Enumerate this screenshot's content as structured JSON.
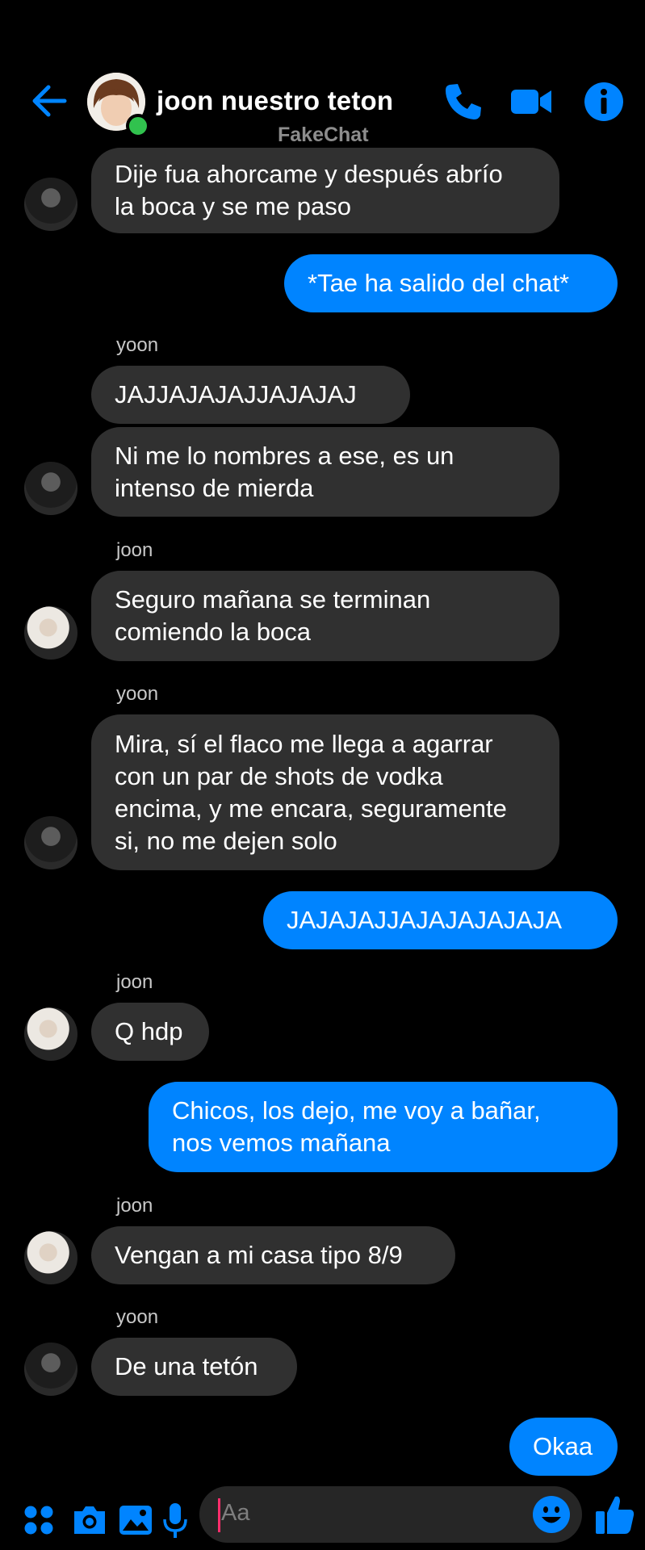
{
  "header": {
    "title": "joon nuestro teton",
    "subtitle": "FakeChat"
  },
  "messages": [
    {
      "text": "Dije fua ahorcame y después abrío\nla boca y se me paso"
    },
    {
      "text": "*Tae ha salido del chat*"
    },
    {
      "sender": "yoon"
    },
    {
      "text": "JAJJAJAJAJJAJAJAJ"
    },
    {
      "text": "Ni me lo nombres a ese, es un\nintenso de mierda"
    },
    {
      "sender": "joon"
    },
    {
      "text": "Seguro mañana se terminan\ncomiendo la boca"
    },
    {
      "sender": "yoon"
    },
    {
      "text": "Mira, sí el flaco me llega a agarrar\ncon un par de shots de vodka\nencima, y me encara, seguramente\nsi, no me dejen solo"
    },
    {
      "text": "JAJAJAJJAJAJAJAJAJA"
    },
    {
      "sender": "joon"
    },
    {
      "text": "Q hdp"
    },
    {
      "text": "Chicos, los dejo, me voy a bañar,\nnos vemos mañana"
    },
    {
      "sender": "joon"
    },
    {
      "text": "Vengan a mi casa tipo 8/9"
    },
    {
      "sender": "yoon"
    },
    {
      "text": "De una tetón"
    },
    {
      "text": "Okaa"
    }
  ],
  "composer": {
    "placeholder": "Aa"
  },
  "colors": {
    "accent": "#0084ff",
    "incoming_bubble": "#303030",
    "background": "#000000",
    "online": "#31c24e"
  }
}
